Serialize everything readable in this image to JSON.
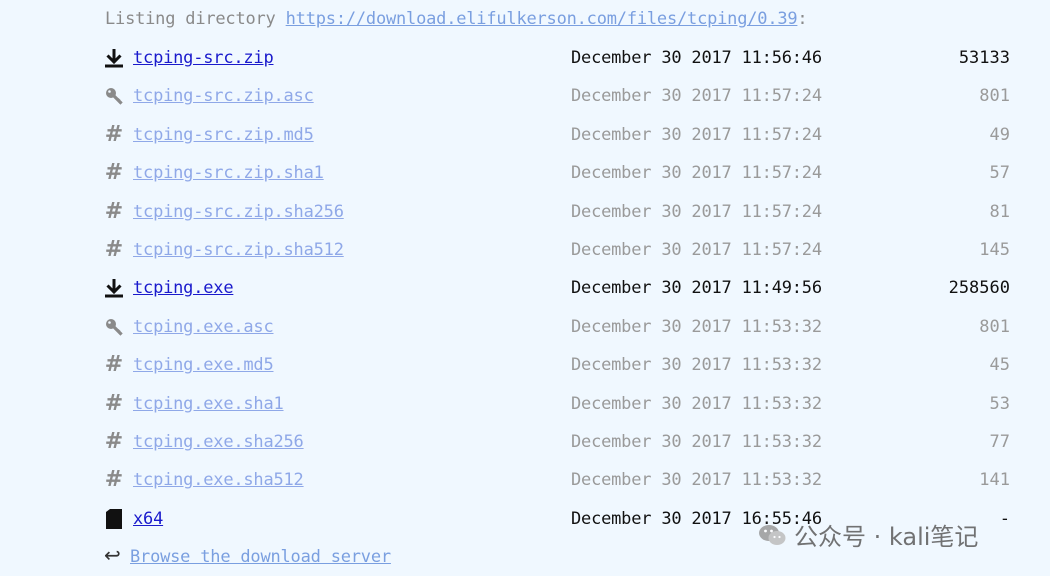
{
  "header": {
    "prefix": "Listing directory ",
    "url": "https://download.elifulkerson.com/files/tcping/0.39",
    "suffix": ":"
  },
  "files": [
    {
      "name": "tcping-src.zip",
      "date": "December 30 2017 11:56:46",
      "size": "53133",
      "icon": "download-icon",
      "kind": "primary"
    },
    {
      "name": "tcping-src.zip.asc",
      "date": "December 30 2017 11:57:24",
      "size": "801",
      "icon": "key-icon",
      "kind": "secondary"
    },
    {
      "name": "tcping-src.zip.md5",
      "date": "December 30 2017 11:57:24",
      "size": "49",
      "icon": "hash-icon",
      "kind": "secondary"
    },
    {
      "name": "tcping-src.zip.sha1",
      "date": "December 30 2017 11:57:24",
      "size": "57",
      "icon": "hash-icon",
      "kind": "secondary"
    },
    {
      "name": "tcping-src.zip.sha256",
      "date": "December 30 2017 11:57:24",
      "size": "81",
      "icon": "hash-icon",
      "kind": "secondary"
    },
    {
      "name": "tcping-src.zip.sha512",
      "date": "December 30 2017 11:57:24",
      "size": "145",
      "icon": "hash-icon",
      "kind": "secondary"
    },
    {
      "name": "tcping.exe",
      "date": "December 30 2017 11:49:56",
      "size": "258560",
      "icon": "download-icon",
      "kind": "primary"
    },
    {
      "name": "tcping.exe.asc",
      "date": "December 30 2017 11:53:32",
      "size": "801",
      "icon": "key-icon",
      "kind": "secondary"
    },
    {
      "name": "tcping.exe.md5",
      "date": "December 30 2017 11:53:32",
      "size": "45",
      "icon": "hash-icon",
      "kind": "secondary"
    },
    {
      "name": "tcping.exe.sha1",
      "date": "December 30 2017 11:53:32",
      "size": "53",
      "icon": "hash-icon",
      "kind": "secondary"
    },
    {
      "name": "tcping.exe.sha256",
      "date": "December 30 2017 11:53:32",
      "size": "77",
      "icon": "hash-icon",
      "kind": "secondary"
    },
    {
      "name": "tcping.exe.sha512",
      "date": "December 30 2017 11:53:32",
      "size": "141",
      "icon": "hash-icon",
      "kind": "secondary"
    },
    {
      "name": "x64",
      "date": "December 30 2017 16:55:46",
      "size": "-",
      "icon": "folder-icon",
      "kind": "dir"
    }
  ],
  "footer": {
    "back_label": "Browse the download server"
  },
  "watermark": {
    "text": "公众号 · kali笔记"
  }
}
